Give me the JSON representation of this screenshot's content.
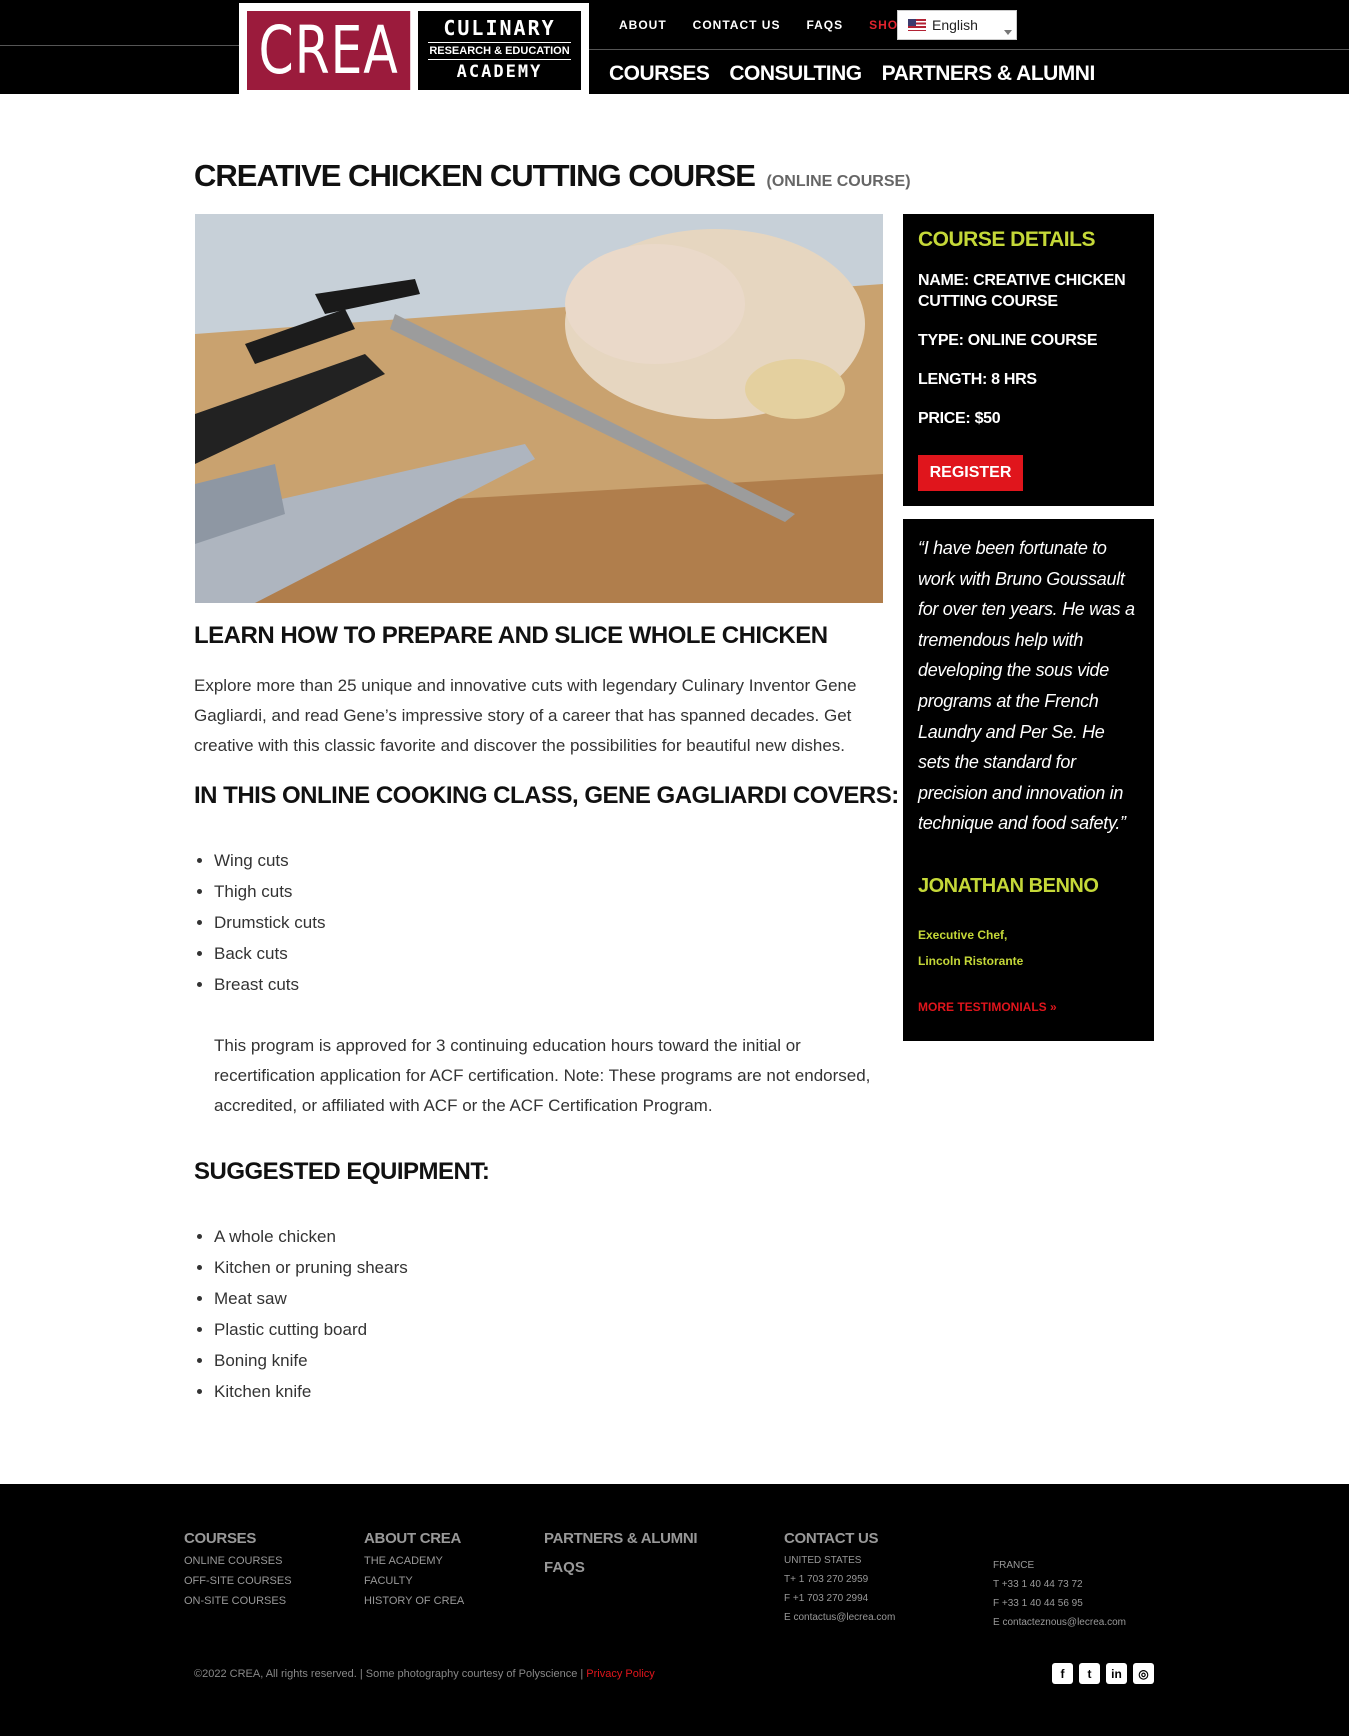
{
  "header": {
    "logo": {
      "crea": "CREA",
      "line1": "CULINARY",
      "line2": "RESEARCH & EDUCATION",
      "line3": "ACADEMY"
    },
    "top_nav": [
      "ABOUT",
      "CONTACT US",
      "FAQS",
      "SHOP"
    ],
    "language": "English",
    "main_nav": [
      "COURSES",
      "CONSULTING",
      "PARTNERS & ALUMNI"
    ]
  },
  "page": {
    "title": "CREATIVE CHICKEN CUTTING COURSE",
    "title_sub": "(ONLINE COURSE)",
    "heading1": "LEARN HOW TO PREPARE AND SLICE WHOLE CHICKEN",
    "intro": "Explore more than 25 unique and innovative cuts with legendary Culinary Inventor Gene Gagliardi, and read Gene’s impressive story of a career that has spanned decades. Get creative with this classic favorite and discover the possibilities for beautiful new dishes.",
    "heading2": "IN THIS ONLINE COOKING CLASS, GENE GAGLIARDI COVERS:",
    "covers": [
      "Wing cuts",
      "Thigh cuts",
      "Drumstick cuts",
      "Back cuts",
      "Breast cuts"
    ],
    "acf_note": "This program is approved for 3 continuing education hours toward the initial or recertification application for ACF certification. Note: These programs are not endorsed, accredited, or affiliated with ACF or the ACF Certification Program.",
    "heading3": "SUGGESTED EQUIPMENT:",
    "equipment": [
      "A whole chicken",
      "Kitchen or pruning shears",
      "Meat saw",
      "Plastic cutting board",
      "Boning knife",
      "Kitchen knife"
    ]
  },
  "details": {
    "heading": "COURSE DETAILS",
    "name": "NAME: CREATIVE CHICKEN CUTTING COURSE",
    "type": "TYPE: ONLINE COURSE",
    "length": "LENGTH: 8 HRS",
    "price": "PRICE: $50",
    "register": "REGISTER"
  },
  "testimonial": {
    "quote": "“I have been fortunate to work with Bruno Goussault for over ten years. He was a tremendous help with developing the sous vide programs at the French Laundry and Per Se. He sets the standard for precision and innovation in technique and food safety.”",
    "name": "JONATHAN BENNO",
    "role1": "Executive Chef,",
    "role2": "Lincoln Ristorante",
    "more": "MORE TESTIMONIALS »"
  },
  "footer": {
    "courses": {
      "heading": "COURSES",
      "links": [
        "ONLINE COURSES",
        "OFF-SITE COURSES",
        "ON-SITE COURSES"
      ]
    },
    "about": {
      "heading": "ABOUT CREA",
      "links": [
        "THE ACADEMY",
        "FACULTY",
        "HISTORY OF CREA"
      ]
    },
    "partners": "PARTNERS & ALUMNI",
    "faqs": "FAQS",
    "contact": {
      "heading": "CONTACT US",
      "us": [
        "UNITED STATES",
        "T+ 1 703 270 2959",
        "F +1 703 270 2994",
        "E contactus@lecrea.com"
      ],
      "fr": [
        "FRANCE",
        "T +33 1 40 44 73 72",
        "F +33 1 40 44 56 95",
        "E contacteznous@lecrea.com"
      ]
    },
    "copyright": "©2022 CREA, All rights reserved. | Some photography courtesy of Polyscience | ",
    "privacy": "Privacy Policy",
    "social": [
      "facebook-icon",
      "twitter-icon",
      "linkedin-icon",
      "instagram-icon"
    ]
  }
}
